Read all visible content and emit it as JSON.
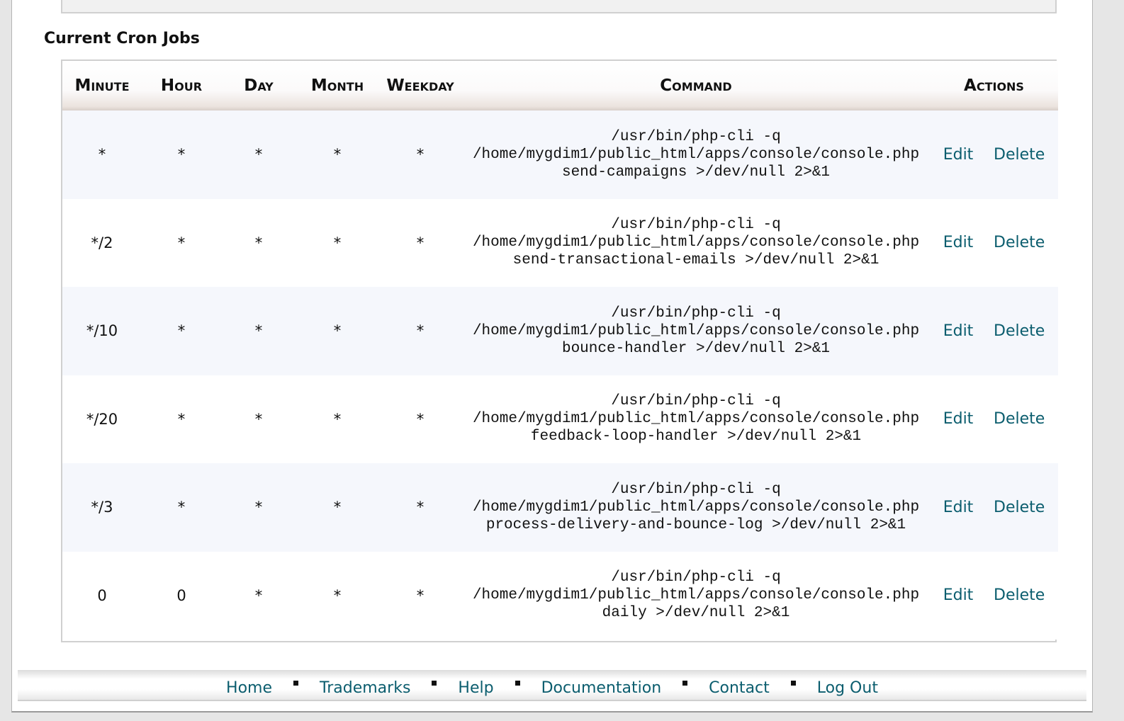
{
  "section_title": "Current Cron Jobs",
  "table": {
    "headers": {
      "minute": "Minute",
      "hour": "Hour",
      "day": "Day",
      "month": "Month",
      "weekday": "Weekday",
      "command": "Command",
      "actions": "Actions"
    },
    "rows": [
      {
        "minute": "*",
        "hour": "*",
        "day": "*",
        "month": "*",
        "weekday": "*",
        "command": [
          "/usr/bin/php-cli -q",
          "/home/mygdim1/public_html/apps/console/console.php",
          "send-campaigns >/dev/null 2>&1"
        ],
        "edit": "Edit",
        "delete": "Delete"
      },
      {
        "minute": "*/2",
        "hour": "*",
        "day": "*",
        "month": "*",
        "weekday": "*",
        "command": [
          "/usr/bin/php-cli -q",
          "/home/mygdim1/public_html/apps/console/console.php",
          "send-transactional-emails >/dev/null 2>&1"
        ],
        "edit": "Edit",
        "delete": "Delete"
      },
      {
        "minute": "*/10",
        "hour": "*",
        "day": "*",
        "month": "*",
        "weekday": "*",
        "command": [
          "/usr/bin/php-cli -q",
          "/home/mygdim1/public_html/apps/console/console.php",
          "bounce-handler >/dev/null 2>&1"
        ],
        "edit": "Edit",
        "delete": "Delete"
      },
      {
        "minute": "*/20",
        "hour": "*",
        "day": "*",
        "month": "*",
        "weekday": "*",
        "command": [
          "/usr/bin/php-cli -q",
          "/home/mygdim1/public_html/apps/console/console.php",
          "feedback-loop-handler >/dev/null 2>&1"
        ],
        "edit": "Edit",
        "delete": "Delete"
      },
      {
        "minute": "*/3",
        "hour": "*",
        "day": "*",
        "month": "*",
        "weekday": "*",
        "command": [
          "/usr/bin/php-cli -q",
          "/home/mygdim1/public_html/apps/console/console.php",
          "process-delivery-and-bounce-log >/dev/null 2>&1"
        ],
        "edit": "Edit",
        "delete": "Delete"
      },
      {
        "minute": "0",
        "hour": "0",
        "day": "*",
        "month": "*",
        "weekday": "*",
        "command": [
          "/usr/bin/php-cli -q",
          "/home/mygdim1/public_html/apps/console/console.php",
          "daily >/dev/null 2>&1"
        ],
        "edit": "Edit",
        "delete": "Delete"
      }
    ]
  },
  "footer": {
    "links": [
      "Home",
      "Trademarks",
      "Help",
      "Documentation",
      "Contact",
      "Log Out"
    ]
  },
  "colors": {
    "link": "#0b5d6e",
    "row_alt": "#f5f7fc"
  }
}
